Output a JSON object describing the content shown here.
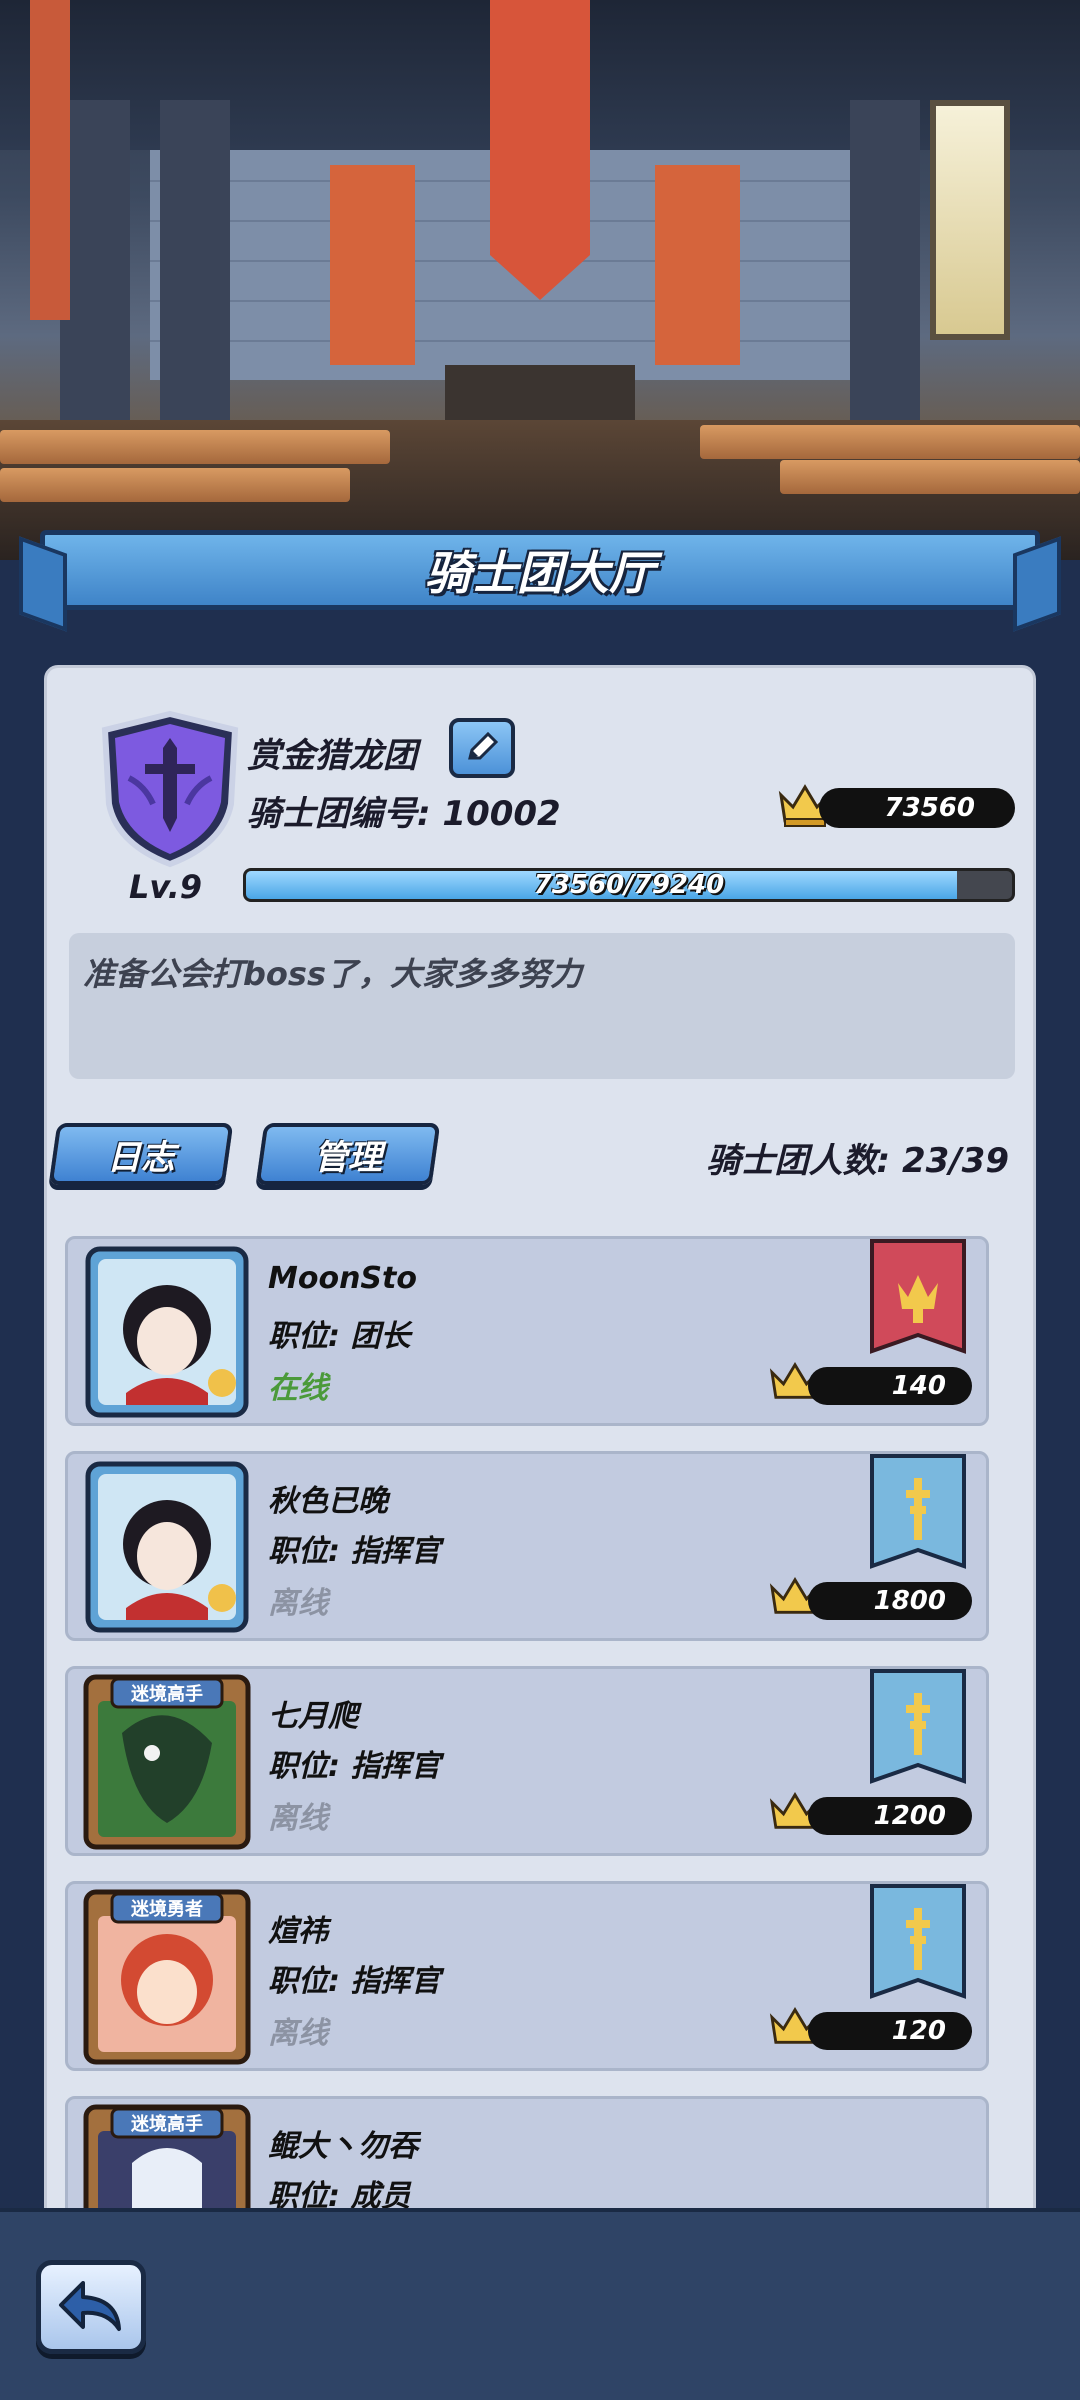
{
  "header": {
    "title": "骑士团大厅"
  },
  "guild": {
    "name": "赏金猎龙团",
    "id_text": "骑士团编号: 10002",
    "level": "Lv.9",
    "score": "73560",
    "exp_text": "73560/79240",
    "exp_progress": 0.928,
    "notice": "准备公会打boss了，大家多多努力"
  },
  "tabs": {
    "log_label": "日志",
    "manage_label": "管理"
  },
  "member_count": "骑士团人数: 23/39",
  "members": [
    {
      "name": "MoonSto",
      "role": "职位: 团长",
      "status": "在线",
      "score": "140",
      "rank": "leader"
    },
    {
      "name": "秋色已晚",
      "role": "职位: 指挥官",
      "status": "离线",
      "score": "1800",
      "rank": "commander"
    },
    {
      "name": "七月爬",
      "role": "职位: 指挥官",
      "status": "离线",
      "score": "1200",
      "rank": "commander"
    },
    {
      "name": "煊祎",
      "role": "职位: 指挥官",
      "status": "离线",
      "score": "120",
      "rank": "commander"
    },
    {
      "name": "鲲大丶勿吞",
      "role": "职位: 成员",
      "status": "",
      "score": "",
      "rank": "member"
    }
  ],
  "avatar_frame_labels": [
    "迷境高手",
    "迷境勇者",
    "迷境高手"
  ],
  "colors": {
    "accent_blue": "#4c92d8",
    "panel": "#dde3ee",
    "card": "#c2cbe0",
    "online": "#4b9a3a",
    "offline": "#8c93a3",
    "leader_flag": "#d04a5a",
    "commander_flag": "#7ab8de"
  },
  "icons": {
    "edit": "pencil-icon",
    "score": "crown-icon",
    "back": "back-arrow-icon",
    "emblem": "sword-shield-icon"
  }
}
